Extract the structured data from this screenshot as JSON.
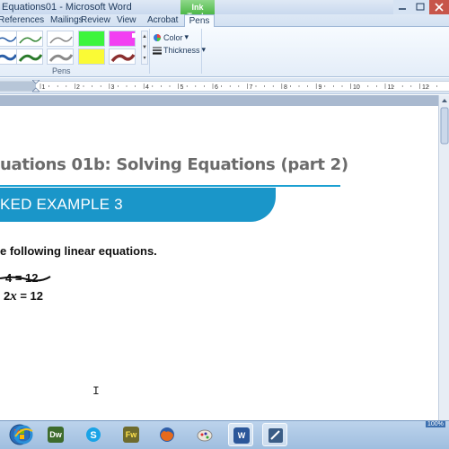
{
  "window": {
    "title": "Equations01 - Microsoft Word",
    "context_tab": "Ink Tools"
  },
  "ribbon_tabs": [
    {
      "label": "References"
    },
    {
      "label": "Mailings"
    },
    {
      "label": "Review"
    },
    {
      "label": "View"
    },
    {
      "label": "Acrobat"
    },
    {
      "label": "Pens"
    }
  ],
  "pens_group": {
    "label": "Pens",
    "color_label": "Color",
    "thickness_label": "Thickness"
  },
  "document": {
    "heading": "uations 01b: Solving Equations (part 2)",
    "banner": "KED EXAMPLE 3",
    "instruction": "e following linear equations.",
    "eq_a": "4 = 12",
    "eq_b_prefix": "2",
    "eq_b_var": "x",
    "eq_b_suffix": " = 12"
  },
  "taskbar": {
    "items": [
      {
        "icon": "internet-explorer-icon"
      },
      {
        "icon": "dreamweaver-icon",
        "label": "Dw"
      },
      {
        "icon": "skype-icon"
      },
      {
        "icon": "fireworks-icon",
        "label": "Fw"
      },
      {
        "icon": "firefox-icon"
      },
      {
        "icon": "paint-icon"
      },
      {
        "icon": "word-icon",
        "label": "W"
      },
      {
        "icon": "camtasia-icon"
      }
    ],
    "zoom": "100%"
  },
  "colors": {
    "banner": "#1a96c9",
    "heading_rule": "#1ba0d2",
    "ink_tools_tab": "#4db848"
  }
}
